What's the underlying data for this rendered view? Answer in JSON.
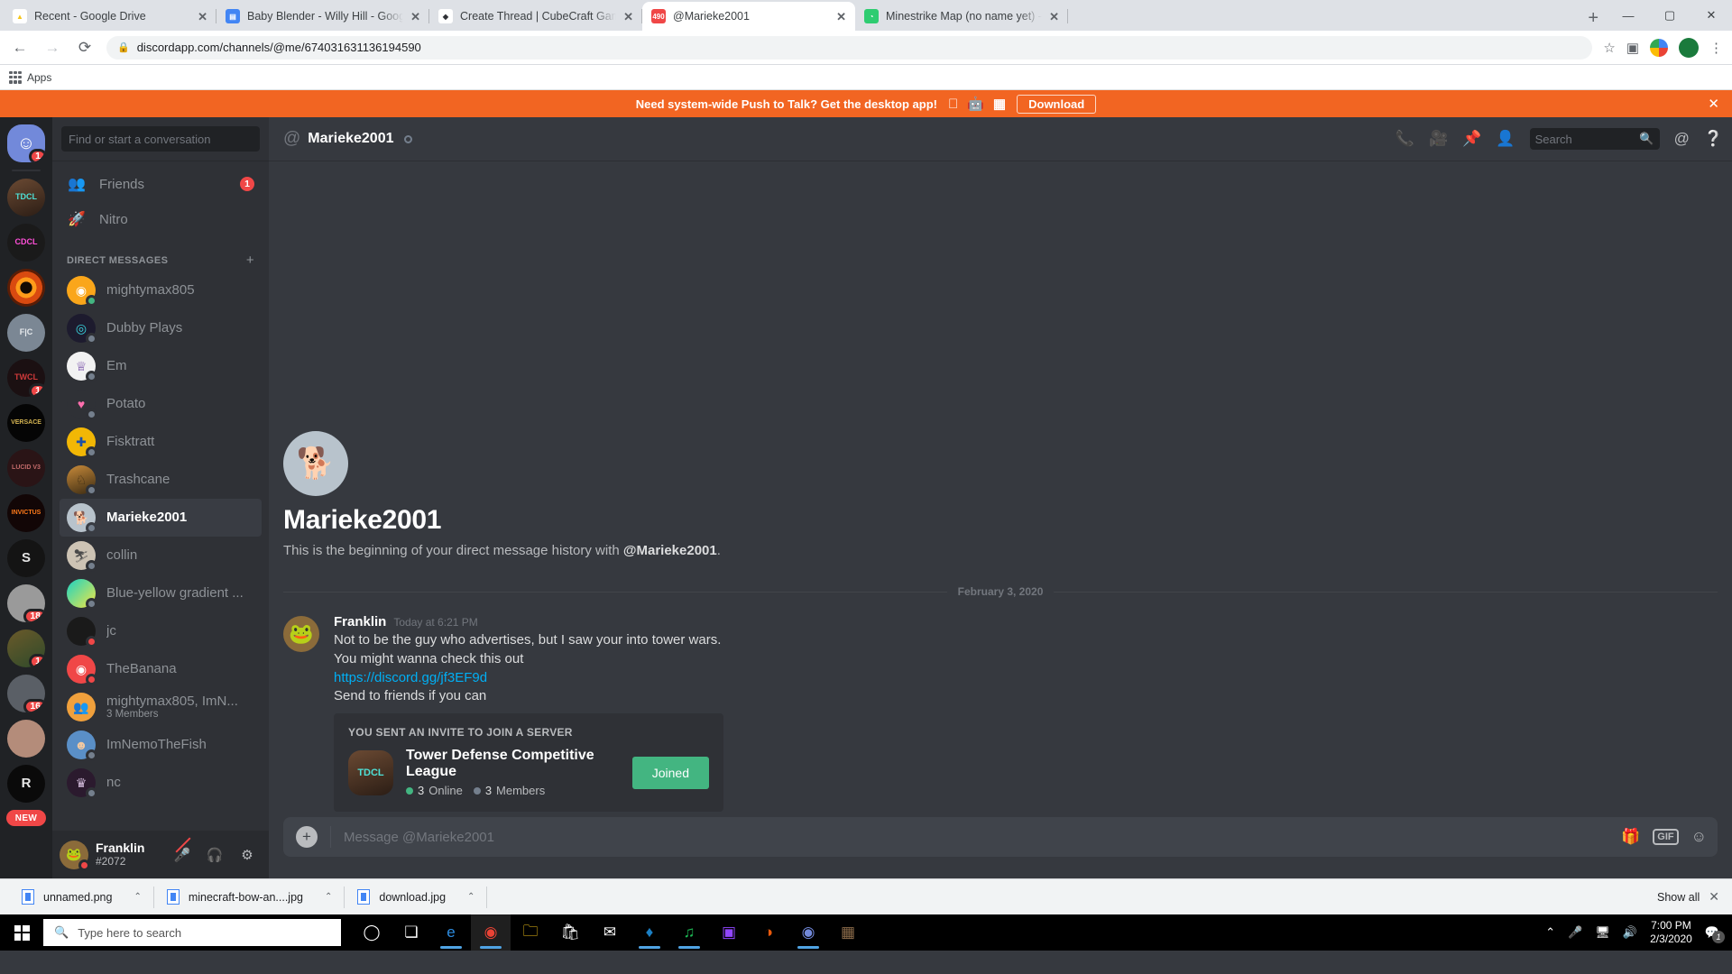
{
  "browser": {
    "tabs": [
      {
        "title": "Recent - Google Drive",
        "favicon": "google-drive-icon",
        "active": false,
        "fav_bg": "#ffffff",
        "fav_color": "#f5c518",
        "fav_glyph": "▲"
      },
      {
        "title": "Baby Blender - Willy Hill - Google",
        "favicon": "google-docs-icon",
        "active": false,
        "fav_bg": "#4285f4",
        "fav_color": "#ffffff",
        "fav_glyph": "▤"
      },
      {
        "title": "Create Thread | CubeCraft Games",
        "favicon": "cubecraft-icon",
        "active": false,
        "fav_bg": "#ffffff",
        "fav_color": "#2f3136",
        "fav_glyph": "◆"
      },
      {
        "title": "@Marieke2001",
        "favicon": "discord-icon",
        "active": true,
        "fav_bg": "#f04747",
        "fav_color": "#ffffff",
        "fav_glyph": "490"
      },
      {
        "title": "Minestrike Map (no name yet) - A",
        "favicon": "map-icon",
        "active": false,
        "fav_bg": "#2ecc71",
        "fav_color": "#ffffff",
        "fav_glyph": "◔"
      }
    ],
    "close_label": "✕",
    "newtab_label": "+",
    "window_controls": {
      "minimize": "—",
      "maximize": "▢",
      "close": "✕"
    },
    "nav": {
      "back": "←",
      "forward": "→",
      "reload": "⟳"
    },
    "url": "discordapp.com/channels/@me/674031631136194590",
    "lock_icon": "lock-icon",
    "star_icon": "☆",
    "extension_icon": "▣",
    "menu_icon": "⋮",
    "bookmarks_label": "Apps"
  },
  "promo": {
    "text": "Need system-wide Push to Talk? Get the desktop app!",
    "platforms": [
      "apple-icon",
      "android-icon",
      "windows-icon"
    ],
    "download_label": "Download",
    "close_label": "✕",
    "bg": "#f26522"
  },
  "rail": {
    "home": {
      "name": "discord-home",
      "badge": "1"
    },
    "guilds": [
      {
        "name": "Tower Defense Competitive League",
        "abbr": "TDCL",
        "bg": "linear-gradient(160deg,#6b4a33,#2b1d15)",
        "color": "#4ee0d6",
        "badge": "",
        "pill": false
      },
      {
        "name": "CDCL",
        "abbr": "CDCL",
        "bg": "#1a1a1a",
        "color": "#ff4fd8",
        "badge": "",
        "pill": true
      },
      {
        "name": "Fire Ring",
        "abbr": "",
        "bg": "radial-gradient(circle at 50% 50%, #120a04 0 22%, #ff9b1a 23% 38%, #d94a10 39% 60%, #5a1d06 61% 100%)",
        "color": "#fff",
        "badge": "",
        "pill": false
      },
      {
        "name": "F|C",
        "abbr": "F|C",
        "bg": "#7b8794",
        "color": "#e6e9ec",
        "badge": "",
        "pill": false
      },
      {
        "name": "Tower Wars Competitive League",
        "abbr": "TWCL",
        "bg": "#1b1012",
        "color": "#d03a3a",
        "badge": "1",
        "pill": true
      },
      {
        "name": "Versace",
        "abbr": "VERSACE",
        "bg": "#050505",
        "color": "#d4b452",
        "badge": "",
        "pill": true
      },
      {
        "name": "Lucid V3",
        "abbr": "LUCID V3",
        "bg": "#2a1416",
        "color": "#c26a6a",
        "badge": "",
        "pill": true
      },
      {
        "name": "Invictus",
        "abbr": "INVICTUS",
        "bg": "#120606",
        "color": "#ff7a1a",
        "badge": "",
        "pill": true
      },
      {
        "name": "S Logo",
        "abbr": "S",
        "bg": "#141414",
        "color": "#e2e2e2",
        "badge": "",
        "pill": false
      },
      {
        "name": "Frog Server",
        "abbr": "",
        "bg": "#9a9a9a",
        "color": "#3fa34d",
        "badge": "18",
        "pill": true
      },
      {
        "name": "Card Server",
        "abbr": "",
        "bg": "linear-gradient(150deg,#6b5a2a,#2e4a2a)",
        "color": "#cfc08a",
        "badge": "1",
        "pill": true
      },
      {
        "name": "Person Server",
        "abbr": "",
        "bg": "#5a5f66",
        "color": "#fff",
        "badge": "16",
        "pill": true
      },
      {
        "name": "Face Server",
        "abbr": "",
        "bg": "#b48c7a",
        "color": "#6a5cff",
        "badge": "",
        "pill": false
      },
      {
        "name": "R Logo",
        "abbr": "R",
        "bg": "#0a0a0a",
        "color": "#e8e8e8",
        "badge": "",
        "pill": true
      }
    ],
    "new_label": "NEW"
  },
  "sidebar": {
    "search_placeholder": "Find or start a conversation",
    "nav": [
      {
        "label": "Friends",
        "icon": "friends-icon",
        "glyph": "👥",
        "badge": "1"
      },
      {
        "label": "Nitro",
        "icon": "nitro-icon",
        "glyph": "🚀",
        "badge": ""
      }
    ],
    "dm_header": "DIRECT MESSAGES",
    "dm_add_label": "+",
    "dms": [
      {
        "name": "mightymax805",
        "status": "online",
        "active": false,
        "sub": "",
        "av_bg": "#faa61a",
        "av_glyph": "◉",
        "av_color": "#ffffff"
      },
      {
        "name": "Dubby Plays",
        "status": "offline",
        "active": false,
        "sub": "",
        "av_bg": "#1d1b2e",
        "av_glyph": "◎",
        "av_color": "#39d7e0"
      },
      {
        "name": "Em",
        "status": "offline",
        "active": false,
        "sub": "",
        "av_bg": "#f2f2f2",
        "av_glyph": "♕",
        "av_color": "#6b3fa0"
      },
      {
        "name": "Potato",
        "status": "offline",
        "active": false,
        "sub": "",
        "av_bg": "#2f3136",
        "av_glyph": "♥",
        "av_color": "#ff6fae"
      },
      {
        "name": "Fisktratt",
        "status": "offline",
        "active": false,
        "sub": "",
        "av_bg": "#f2b705",
        "av_glyph": "✚",
        "av_color": "#1d4fa8"
      },
      {
        "name": "Trashcane",
        "status": "offline",
        "active": false,
        "sub": "",
        "av_bg": "linear-gradient(160deg,#c98b3a,#3a2a12)",
        "av_glyph": "♘",
        "av_color": "#3a2a12"
      },
      {
        "name": "Marieke2001",
        "status": "offline",
        "active": true,
        "sub": "",
        "av_bg": "#b8c3cc",
        "av_glyph": "🐕",
        "av_color": "#ffffff"
      },
      {
        "name": "collin",
        "status": "offline",
        "active": false,
        "sub": "",
        "av_bg": "#cdc3b4",
        "av_glyph": "⛷",
        "av_color": "#4a4a4a"
      },
      {
        "name": "Blue-yellow gradient ...",
        "status": "offline",
        "active": false,
        "sub": "",
        "av_bg": "linear-gradient(135deg,#19d3c5,#f5e642)",
        "av_glyph": "",
        "av_color": "#fff"
      },
      {
        "name": "jc",
        "status": "dnd",
        "active": false,
        "sub": "",
        "av_bg": "#1a1a1a",
        "av_glyph": "",
        "av_color": "#fff"
      },
      {
        "name": "TheBanana",
        "status": "dnd",
        "active": false,
        "sub": "",
        "av_bg": "#f04747",
        "av_glyph": "◉",
        "av_color": "#ffffff"
      },
      {
        "name": "mightymax805, ImN...",
        "status": "",
        "active": false,
        "sub": "3 Members",
        "av_bg": "#f0a03c",
        "av_glyph": "👥",
        "av_color": "#ffffff"
      },
      {
        "name": "ImNemoTheFish",
        "status": "offline",
        "active": false,
        "sub": "",
        "av_bg": "#5a8fc7",
        "av_glyph": "☻",
        "av_color": "#f3c9a0"
      },
      {
        "name": "nc",
        "status": "offline",
        "active": false,
        "sub": "",
        "av_bg": "#2b1a2e",
        "av_glyph": "♛",
        "av_color": "#d8c0e0"
      }
    ],
    "user": {
      "name": "Franklin",
      "tag": "#2072",
      "status": "dnd",
      "av_bg": "#8b6b3a",
      "av_glyph": "🐸",
      "buttons": [
        {
          "name": "mute-button",
          "glyph": "🎤",
          "muted": true
        },
        {
          "name": "deafen-button",
          "glyph": "🎧",
          "muted": false
        },
        {
          "name": "user-settings-button",
          "glyph": "⚙",
          "muted": false
        }
      ]
    }
  },
  "channel": {
    "at_icon": "at-icon",
    "title": "Marieke2001",
    "status": "offline",
    "header_icons": [
      {
        "name": "start-call-icon",
        "glyph": "📞"
      },
      {
        "name": "video-call-icon",
        "glyph": "📹"
      },
      {
        "name": "pinned-messages-icon",
        "glyph": "📌"
      },
      {
        "name": "add-friends-icon",
        "glyph": "👤"
      }
    ],
    "search_placeholder": "Search",
    "search_icon": "search-icon",
    "mentions_icon": "at-icon",
    "help_icon": "help-icon"
  },
  "intro": {
    "avatar_name": "marieke-avatar",
    "name": "Marieke2001",
    "text_before": "This is the beginning of your direct message history with ",
    "mention": "@Marieke2001",
    "text_after": "."
  },
  "date_divider": "February 3, 2020",
  "message": {
    "author": "Franklin",
    "timestamp": "Today at 6:21 PM",
    "avatar_name": "franklin-avatar",
    "lines": [
      "Not to be the guy who advertises, but I saw your into tower wars.",
      "You might wanna check this out"
    ],
    "link": "https://discord.gg/jf3EF9d",
    "line_after": "Send to friends if you can"
  },
  "invite": {
    "header": "YOU SENT AN INVITE TO JOIN A SERVER",
    "server_name": "Tower Defense Competitive League",
    "server_abbr": "TDCL",
    "online": "3",
    "online_label": "Online",
    "members": "3",
    "members_label": "Members",
    "button_label": "Joined",
    "button_color": "#43b581"
  },
  "composer": {
    "add_label": "+",
    "placeholder": "Message @Marieke2001",
    "icons": [
      {
        "name": "gift-icon",
        "glyph": "🎁"
      },
      {
        "name": "gif-icon",
        "glyph": "GIF"
      },
      {
        "name": "emoji-icon",
        "glyph": "☺"
      }
    ]
  },
  "downloads": {
    "items": [
      {
        "name": "unnamed.png",
        "caret": "⌃"
      },
      {
        "name": "minecraft-bow-an....jpg",
        "caret": "⌃"
      },
      {
        "name": "download.jpg",
        "caret": "⌃"
      }
    ],
    "show_all": "Show all",
    "close": "✕"
  },
  "taskbar": {
    "search_placeholder": "Type here to search",
    "search_icon": "search-icon",
    "start_icon": "windows-start-icon",
    "items": [
      {
        "name": "cortana-icon",
        "glyph": "◯",
        "bg": "",
        "color": "#ffffff",
        "active": false,
        "underline": false
      },
      {
        "name": "task-view-icon",
        "glyph": "❏",
        "bg": "",
        "color": "#ffffff",
        "active": false,
        "underline": false
      },
      {
        "name": "edge-icon",
        "glyph": "e",
        "bg": "",
        "color": "#2d8ce0",
        "active": false,
        "underline": true
      },
      {
        "name": "chrome-icon",
        "glyph": "◉",
        "bg": "",
        "color": "#ea4335",
        "active": true,
        "underline": true
      },
      {
        "name": "file-explorer-icon",
        "glyph": "🗀",
        "bg": "",
        "color": "#f5c518",
        "active": false,
        "underline": false
      },
      {
        "name": "microsoft-store-icon",
        "glyph": "🛍",
        "bg": "",
        "color": "#ffffff",
        "active": false,
        "underline": false
      },
      {
        "name": "mail-icon",
        "glyph": "✉",
        "bg": "",
        "color": "#ffffff",
        "active": false,
        "underline": false
      },
      {
        "name": "steam-icon",
        "glyph": "♦",
        "bg": "",
        "color": "#1b7fc4",
        "active": false,
        "underline": true
      },
      {
        "name": "spotify-icon",
        "glyph": "♫",
        "bg": "",
        "color": "#1db954",
        "active": false,
        "underline": true
      },
      {
        "name": "twitch-icon",
        "glyph": "▣",
        "bg": "",
        "color": "#9146ff",
        "active": false,
        "underline": false
      },
      {
        "name": "firefox-icon",
        "glyph": "◑",
        "bg": "",
        "color": "#e8590c",
        "active": false,
        "underline": false
      },
      {
        "name": "discord-icon",
        "glyph": "◉",
        "bg": "",
        "color": "#7289da",
        "active": false,
        "underline": true
      },
      {
        "name": "minecraft-icon",
        "glyph": "▦",
        "bg": "",
        "color": "#8b6b4a",
        "active": false,
        "underline": false
      }
    ],
    "tray": {
      "chevron": "⌃",
      "mic_icon": "microphone-icon",
      "network_icon": "network-icon",
      "volume_icon": "volume-icon",
      "time": "7:00 PM",
      "date": "2/3/2020",
      "notifications_icon": "notifications-icon",
      "notifications_count": "1"
    }
  }
}
